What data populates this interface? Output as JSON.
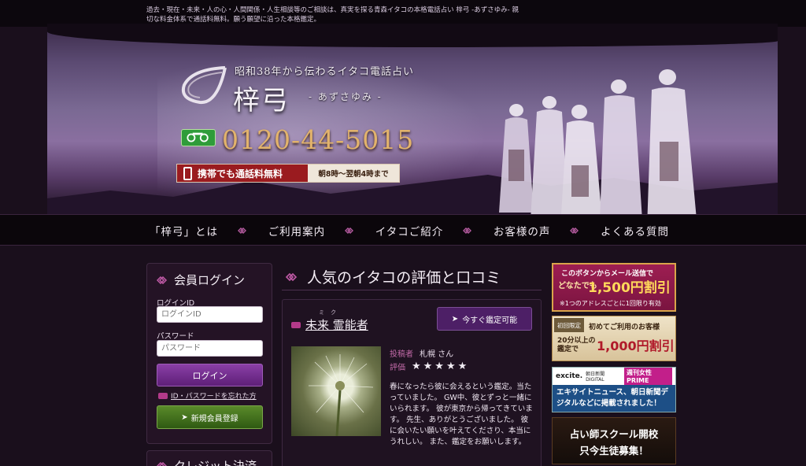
{
  "intro": "過去・現在・未来・人の心・人間関係・人生相談等のご相談は、真実を探る青森イタコの本格電話占い 梓弓 -あずさゆみ- 親切な料金体系で通話料無料。願う願望に沿った本格鑑定。",
  "header": {
    "tagline": "昭和38年から伝わるイタコ電話占い",
    "brand": "梓弓",
    "brand_kana": "- あずさゆみ -",
    "phone": "0120-44-5015",
    "free_call": "携帯でも通話料無料",
    "hours": "朝8時～翌朝4時まで"
  },
  "nav": {
    "items": [
      "「梓弓」とは",
      "ご利用案内",
      "イタコご紹介",
      "お客様の声",
      "よくある質問"
    ]
  },
  "sidebar": {
    "title": "会員ログイン",
    "login_id_label": "ログインID",
    "login_id_placeholder": "ログインID",
    "password_label": "パスワード",
    "password_placeholder": "パスワード",
    "login_button": "ログイン",
    "forgot_link": "ID・パスワードを忘れた方",
    "register_button": "新規会員登録",
    "next_section_title": "クレジット決済"
  },
  "main": {
    "title": "人気のイタコの評価と口コミ",
    "review": {
      "ruby": "ミク",
      "reader_name": "未来 霊能者",
      "available_button": "今すぐ鑑定可能",
      "poster_label": "投稿者",
      "poster_value": "札幌 さん",
      "rating_label": "評価",
      "stars": "★★★★★",
      "rating": 5,
      "body": "春になったら彼に会えるという鑑定。当たっていました。 GW中、彼とずっと一緒にいられます。 彼が東京から帰ってきています。 先生、ありがとうございました。 彼に会いたい願いを叶えてくださり、本当にうれしい。 また、鑑定をお願いします。"
    }
  },
  "banners": {
    "mail": {
      "line1": "このボタンからメール送信で",
      "line2": "どなたでも",
      "line3": "1,500円割引",
      "line4": "※1つのアドレスごとに1回限り有効"
    },
    "first": {
      "tag": "初回限定",
      "line1": "初めてご利用のお客様",
      "line2": "20分以上の鑑定で",
      "line3": "1,000円割引"
    },
    "media": {
      "excite": "excite.",
      "asahi": "朝日新聞 DIGITAL",
      "prime": "週刊女性PRIME",
      "body": "エキサイトニュース、朝日新聞デジタルなどに掲載されました！"
    },
    "school": {
      "line1": "占い師スクール開校",
      "line2": "只今生徒募集！"
    }
  }
}
